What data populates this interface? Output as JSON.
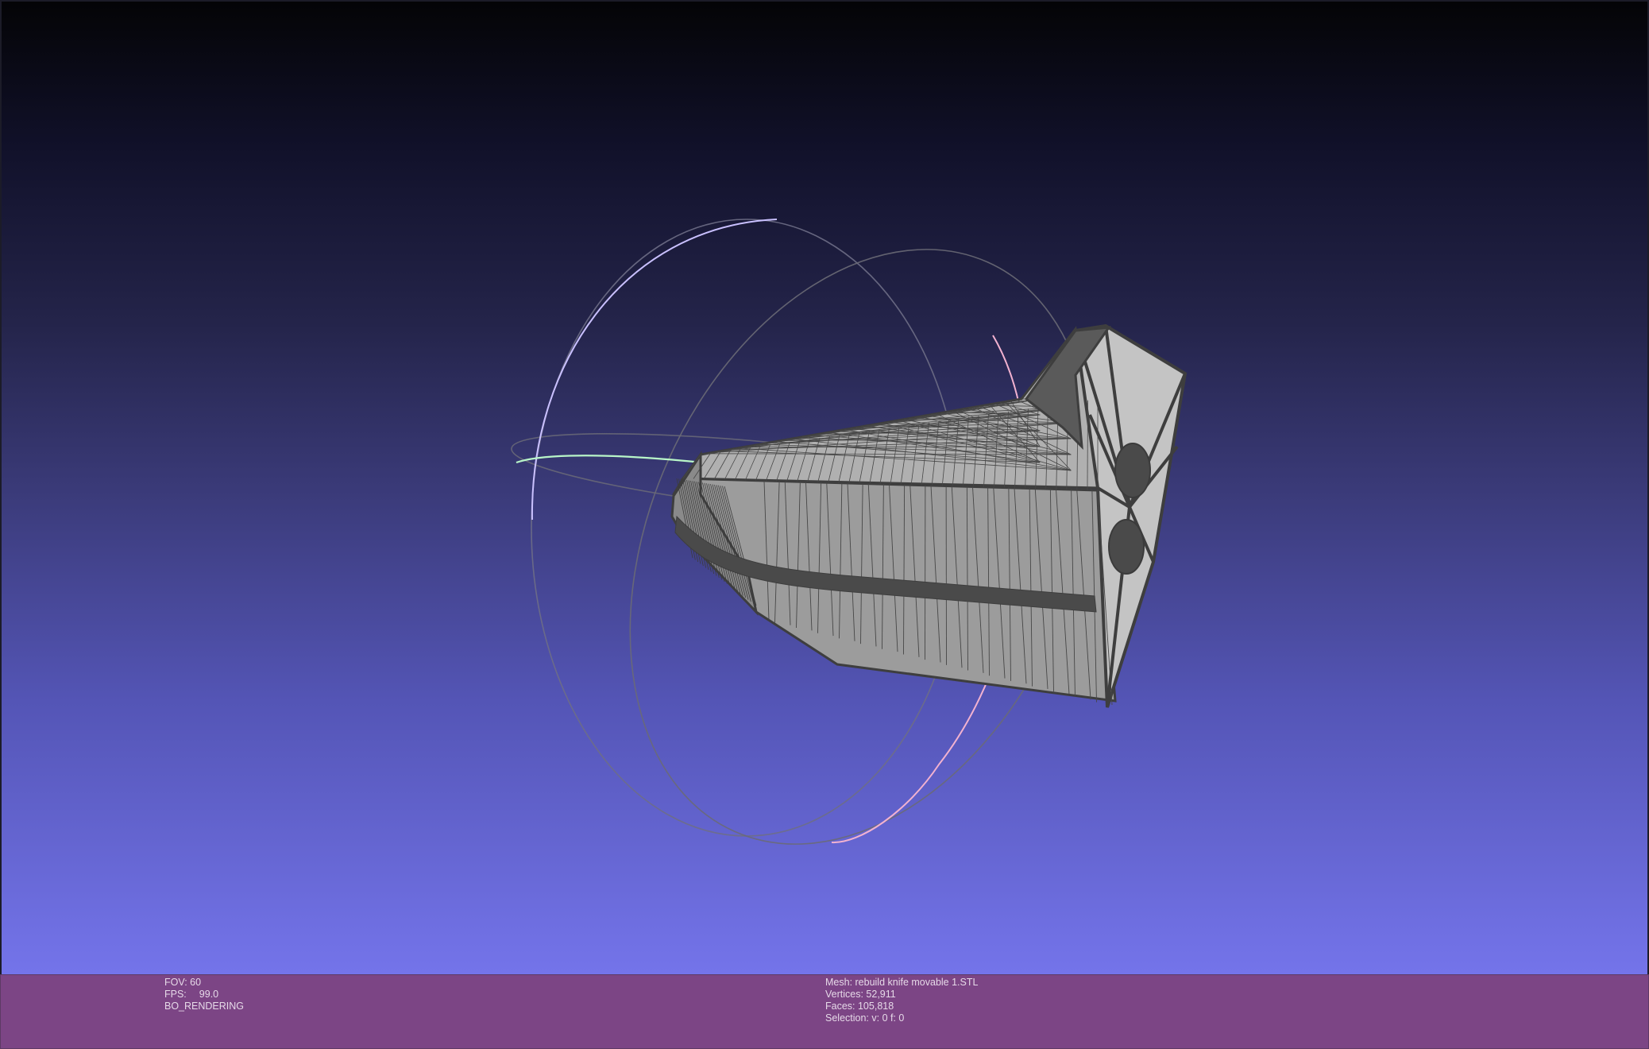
{
  "app": {
    "viewport_background": {
      "top": "#040406",
      "bottom": "#7474ea"
    },
    "info_bar_color": "#7c4585"
  },
  "info_left": {
    "fov": "FOV: 60",
    "fps_label": "FPS:",
    "fps_value": "99.0",
    "render_mode": "BO_RENDERING"
  },
  "info_right": {
    "mesh": "Mesh: rebuild knife movable 1.STL",
    "vertices": "Vertices: 52,911",
    "faces": "Faces: 105,818",
    "selection": "Selection: v: 0 f: 0"
  },
  "scene": {
    "mesh_color": "#a6a6a6",
    "wire_color": "#3f3f3f",
    "trackball": {
      "x_ring_color": "#cfc6ff",
      "y_ring_color": "#ffb8d6",
      "z_ring_color": "#aef2c0",
      "back_color": "#5a5a66"
    }
  }
}
